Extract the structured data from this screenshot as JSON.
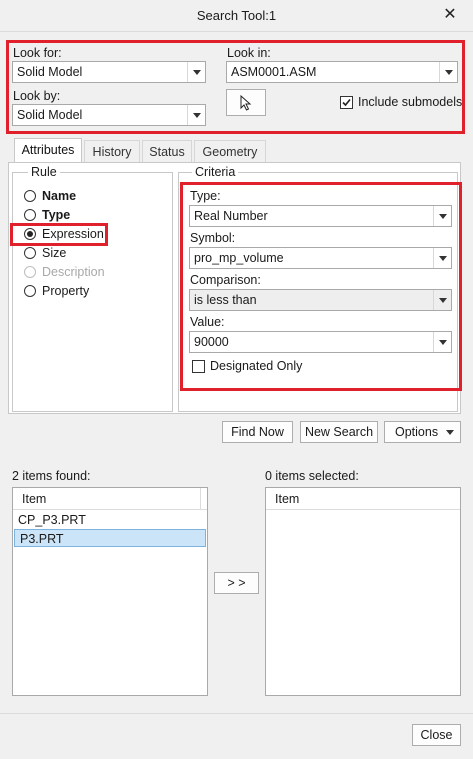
{
  "window": {
    "title": "Search Tool:1"
  },
  "top": {
    "look_for_label": "Look for:",
    "look_for_value": "Solid Model",
    "look_in_label": "Look in:",
    "look_in_value": "ASM0001.ASM",
    "look_by_label": "Look by:",
    "look_by_value": "Solid Model",
    "include_submodels_label": "Include submodels",
    "include_submodels_checked": true
  },
  "tabs": [
    "Attributes",
    "History",
    "Status",
    "Geometry"
  ],
  "rule": {
    "title": "Rule",
    "options": [
      {
        "label": "Name",
        "bold": true,
        "selected": false,
        "disabled": false
      },
      {
        "label": "Type",
        "bold": true,
        "selected": false,
        "disabled": false
      },
      {
        "label": "Expression",
        "bold": false,
        "selected": true,
        "disabled": false
      },
      {
        "label": "Size",
        "bold": false,
        "selected": false,
        "disabled": false
      },
      {
        "label": "Description",
        "bold": false,
        "selected": false,
        "disabled": true
      },
      {
        "label": "Property",
        "bold": false,
        "selected": false,
        "disabled": false
      }
    ]
  },
  "criteria": {
    "title": "Criteria",
    "type_label": "Type:",
    "type_value": "Real Number",
    "symbol_label": "Symbol:",
    "symbol_value": "pro_mp_volume",
    "comparison_label": "Comparison:",
    "comparison_value": "is less than",
    "value_label": "Value:",
    "value_value": "90000",
    "designated_only_label": "Designated Only"
  },
  "actions": {
    "find_now": "Find Now",
    "new_search": "New Search",
    "options": "Options"
  },
  "results": {
    "found_label": "2 items found:",
    "selected_label": "0 items selected:",
    "column_header": "Item",
    "found_items": [
      "CP_P3.PRT",
      "P3.PRT"
    ],
    "transfer_button": "> >"
  },
  "footer": {
    "close": "Close"
  }
}
